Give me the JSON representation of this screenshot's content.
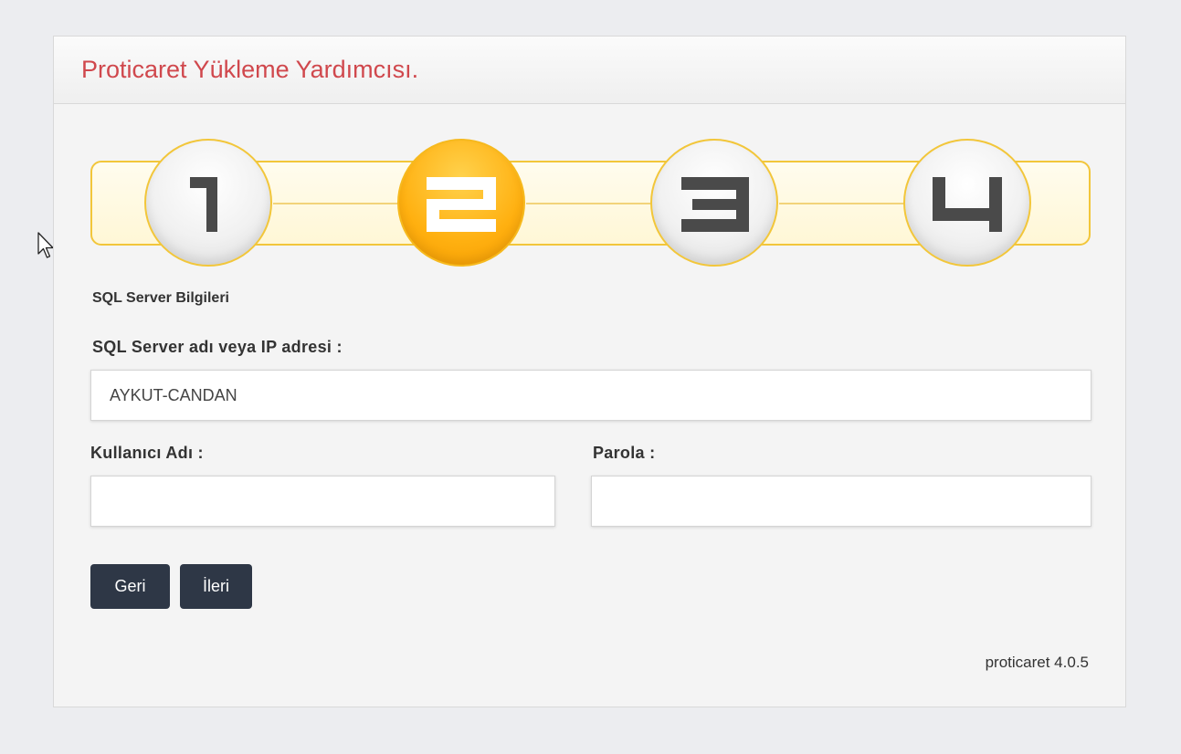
{
  "window": {
    "title": "Proticaret Yükleme Yardımcısı."
  },
  "steps": [
    {
      "number": "1",
      "state": "inactive"
    },
    {
      "number": "2",
      "state": "active"
    },
    {
      "number": "3",
      "state": "inactive"
    },
    {
      "number": "4",
      "state": "inactive"
    }
  ],
  "form": {
    "section_title": "SQL Server Bilgileri",
    "server_label": "SQL Server adı veya IP adresi :",
    "server_value": "AYKUT-CANDAN",
    "username_label": "Kullanıcı Adı :",
    "username_value": "",
    "password_label": "Parola :",
    "password_value": ""
  },
  "buttons": {
    "back_label": "Geri",
    "next_label": "İleri"
  },
  "footer": {
    "version": "proticaret 4.0.5"
  },
  "colors": {
    "title": "#d0484d",
    "active_step": "#ffb010",
    "step_border": "#f2c63a",
    "button_bg": "#2e3746"
  },
  "icons": {
    "cursor": "mouse-pointer-icon"
  }
}
